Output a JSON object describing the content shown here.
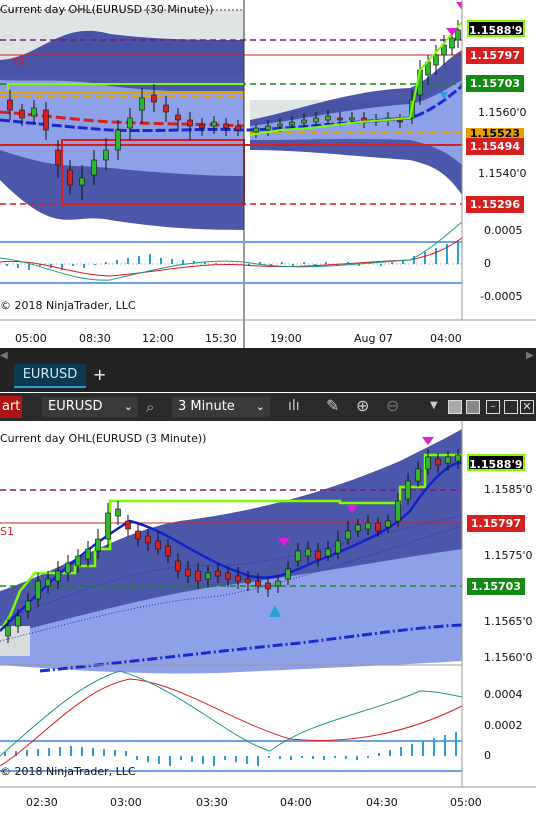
{
  "top_chart": {
    "title": "Current day OHL(EURUSD (30 Minute))",
    "s1_label": "S1",
    "copyright": "© 2018 NinjaTrader, LLC",
    "price_ticks": [
      "1.1560'0",
      "1.1540'0"
    ],
    "price_badges": [
      {
        "text": "1.1588'9",
        "bg": "#000000",
        "fg": "#ffffff",
        "border": "#7CFC00"
      },
      {
        "text": "1.15797",
        "bg": "#d61f1f",
        "fg": "#ffffff"
      },
      {
        "text": "1.15703",
        "bg": "#138a13",
        "fg": "#ffffff"
      },
      {
        "text": "1.15523",
        "bg": "#e5a100",
        "fg": "#000000"
      },
      {
        "text": "1.15494",
        "bg": "#d61f1f",
        "fg": "#ffffff"
      },
      {
        "text": "1.15296",
        "bg": "#d61f1f",
        "fg": "#ffffff"
      }
    ],
    "osc_ticks": [
      "0.0005",
      "0",
      "-0.0005"
    ],
    "time_ticks": [
      "05:00",
      "08:30",
      "12:00",
      "15:30",
      "19:00",
      "Aug 07",
      "04:00"
    ]
  },
  "tabbar": {
    "tab_label": "EURUSD",
    "add_label": "+"
  },
  "toolbar": {
    "chart_label": "art",
    "instrument": "EURUSD",
    "interval": "3 Minute"
  },
  "bottom_chart": {
    "title": "Current day OHL(EURUSD (3 Minute))",
    "s1_label": "S1",
    "copyright": "© 2018 NinjaTrader, LLC",
    "price_ticks": [
      "1.1585'0",
      "1.1575'0",
      "1.1565'0",
      "1.1560'0"
    ],
    "price_badges": [
      {
        "text": "1.1588'9",
        "bg": "#000000",
        "fg": "#ffffff",
        "border": "#7CFC00"
      },
      {
        "text": "1.15797",
        "bg": "#d61f1f",
        "fg": "#ffffff"
      },
      {
        "text": "1.15703",
        "bg": "#138a13",
        "fg": "#ffffff"
      }
    ],
    "osc_ticks": [
      "0.0004",
      "0.0002",
      "0"
    ],
    "time_ticks": [
      "02:30",
      "03:00",
      "03:30",
      "04:00",
      "04:30",
      "05:00"
    ]
  }
}
